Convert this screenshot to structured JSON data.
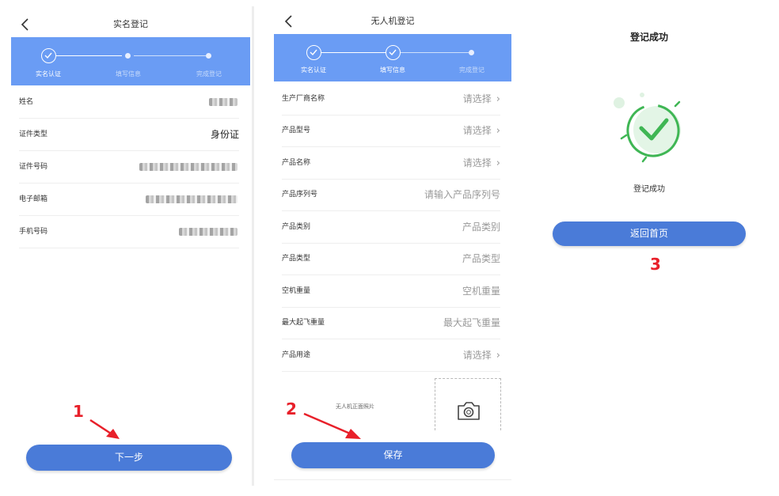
{
  "screen1": {
    "title": "实名登记",
    "steps": [
      "实名认证",
      "填写信息",
      "完成登记"
    ],
    "fields": [
      {
        "label": "姓名",
        "value": ""
      },
      {
        "label": "证件类型",
        "value": "身份证"
      },
      {
        "label": "证件号码",
        "value": ""
      },
      {
        "label": "电子邮箱",
        "value": ""
      },
      {
        "label": "手机号码",
        "value": ""
      }
    ],
    "button": "下一步",
    "marker": "1"
  },
  "screen2": {
    "title": "无人机登记",
    "steps": [
      "实名认证",
      "填写信息",
      "完成登记"
    ],
    "fields": [
      {
        "label": "生产厂商名称",
        "value": "请选择",
        "chevron": true
      },
      {
        "label": "产品型号",
        "value": "请选择",
        "chevron": true
      },
      {
        "label": "产品名称",
        "value": "请选择",
        "chevron": true
      },
      {
        "label": "产品序列号",
        "value": "请输入产品序列号",
        "chevron": false
      },
      {
        "label": "产品类别",
        "value": "产品类别",
        "chevron": false
      },
      {
        "label": "产品类型",
        "value": "产品类型",
        "chevron": false
      },
      {
        "label": "空机重量",
        "value": "空机重量",
        "chevron": false
      },
      {
        "label": "最大起飞重量",
        "value": "最大起飞重量",
        "chevron": false
      },
      {
        "label": "产品用途",
        "value": "请选择",
        "chevron": true
      }
    ],
    "photo_label": "无人机正面照片",
    "button": "保存",
    "marker": "2"
  },
  "screen3": {
    "title": "登记成功",
    "message": "登记成功",
    "button": "返回首页",
    "marker": "3"
  },
  "colors": {
    "step_bar": "#6a9cf4",
    "button": "#4a7bd8",
    "marker": "#e8202a",
    "success_green": "#3fb654"
  },
  "icons": {
    "back": "chevron-left-icon",
    "chevron": "chevron-right-icon",
    "camera": "camera-icon",
    "success": "check-circle-icon"
  }
}
